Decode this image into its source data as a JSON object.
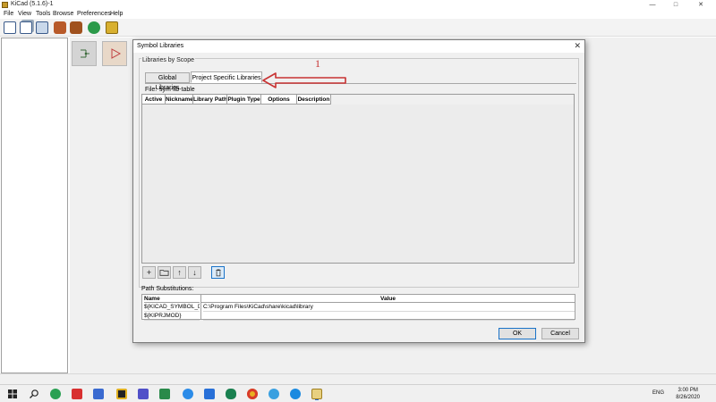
{
  "app": {
    "title": "KiCad (5.1.6)-1",
    "min_label": "—",
    "max_label": "□",
    "close_label": "✕"
  },
  "menu": {
    "items": [
      "File",
      "View",
      "Tools",
      "Browse",
      "Preferences",
      "Help"
    ]
  },
  "toolbar": {
    "buttons": [
      "new-project-icon",
      "new-from-template-icon",
      "open-project-icon",
      "save-icon",
      "archive-icon",
      "unarchive-icon",
      "refresh-icon",
      "project-settings-icon"
    ]
  },
  "dialog": {
    "title": "Symbol Libraries",
    "close_label": "✕",
    "group_label": "Libraries by Scope",
    "tabs": [
      {
        "label": "Global Libraries"
      },
      {
        "label": "Project Specific Libraries"
      }
    ],
    "file_label": "File:",
    "file_value": "sym-lib-table",
    "columns": [
      "Active",
      "Nickname",
      "Library Path",
      "Plugin Type",
      "Options",
      "Description"
    ],
    "actions": {
      "add": "+",
      "browse": "folder-icon",
      "up": "↑",
      "down": "↓",
      "delete": "trash-icon"
    },
    "path_label": "Path Substitutions:",
    "path_columns": [
      "Name",
      "Value"
    ],
    "path_rows": [
      {
        "name": "${KICAD_SYMBOL_DIR}",
        "value": "C:\\Program Files\\KiCad\\share\\kicad\\library"
      },
      {
        "name": "${KIPRJMOD}",
        "value": ""
      }
    ],
    "ok_label": "OK",
    "cancel_label": "Cancel"
  },
  "annotation": {
    "number": "1",
    "color": "#c83232"
  },
  "taskbar": {
    "language": "ENG",
    "time": "3:00 PM",
    "date": "8/26/2020"
  }
}
